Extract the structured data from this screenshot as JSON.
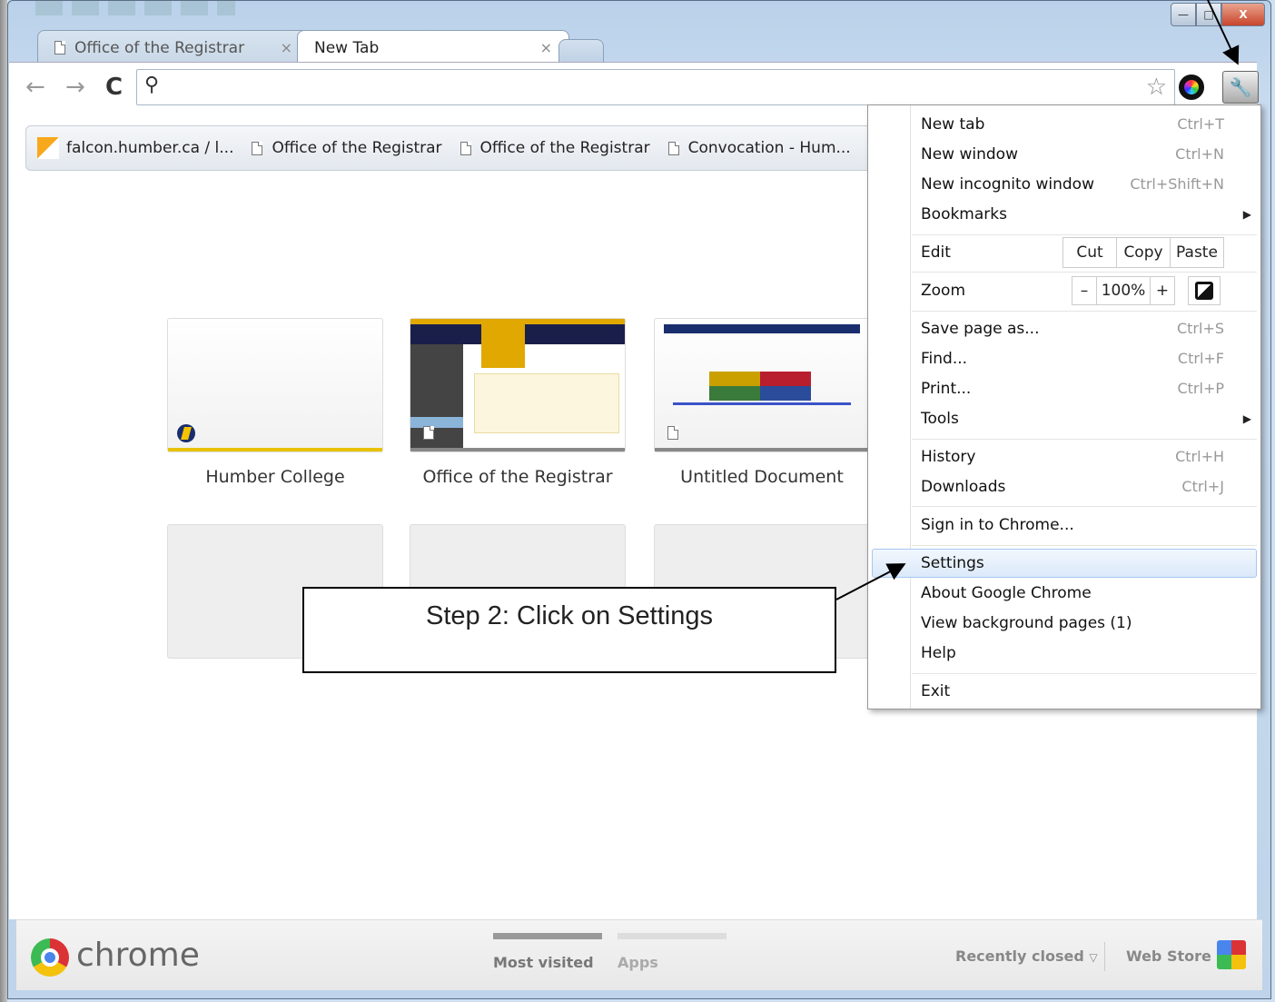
{
  "tabs": [
    {
      "label": "Office of the Registrar",
      "close": "×"
    },
    {
      "label": "New Tab",
      "close": "×"
    }
  ],
  "window_controls": {
    "minimize": "—",
    "maximize": "□",
    "close": "X"
  },
  "omnibox": {
    "value": "",
    "placeholder": ""
  },
  "bookmarks": [
    {
      "label": "falcon.humber.ca / l...",
      "icon": "pma-icon"
    },
    {
      "label": "Office of the Registrar",
      "icon": "page-icon"
    },
    {
      "label": "Office of the Registrar",
      "icon": "page-icon"
    },
    {
      "label": "Convocation - Hum...",
      "icon": "page-icon"
    }
  ],
  "thumbnails": [
    {
      "label": "Humber College"
    },
    {
      "label": "Office of the Registrar"
    },
    {
      "label": "Untitled Document"
    }
  ],
  "menu": {
    "new_tab": {
      "label": "New tab",
      "shortcut": "Ctrl+T"
    },
    "new_window": {
      "label": "New window",
      "shortcut": "Ctrl+N"
    },
    "new_incognito": {
      "label": "New incognito window",
      "shortcut": "Ctrl+Shift+N"
    },
    "bookmarks": {
      "label": "Bookmarks"
    },
    "edit": {
      "label": "Edit",
      "cut": "Cut",
      "copy": "Copy",
      "paste": "Paste"
    },
    "zoom": {
      "label": "Zoom",
      "minus": "–",
      "value": "100%",
      "plus": "+"
    },
    "save_page": {
      "label": "Save page as...",
      "shortcut": "Ctrl+S"
    },
    "find": {
      "label": "Find...",
      "shortcut": "Ctrl+F"
    },
    "print": {
      "label": "Print...",
      "shortcut": "Ctrl+P"
    },
    "tools": {
      "label": "Tools"
    },
    "history": {
      "label": "History",
      "shortcut": "Ctrl+H"
    },
    "downloads": {
      "label": "Downloads",
      "shortcut": "Ctrl+J"
    },
    "sign_in": {
      "label": "Sign in to Chrome..."
    },
    "settings": {
      "label": "Settings"
    },
    "about": {
      "label": "About Google Chrome"
    },
    "background_pages": {
      "label": "View background pages (1)"
    },
    "help": {
      "label": "Help"
    },
    "exit": {
      "label": "Exit"
    }
  },
  "footer": {
    "brand": "chrome",
    "most_visited": "Most visited",
    "apps": "Apps",
    "recently_closed": "Recently closed",
    "web_store": "Web Store"
  },
  "callout": {
    "text": "Step 2: Click on Settings"
  },
  "colors": {
    "accent_yellow": "#e8c200",
    "highlight": "#dbe9fa",
    "humber_navy": "#1a2e6e"
  }
}
